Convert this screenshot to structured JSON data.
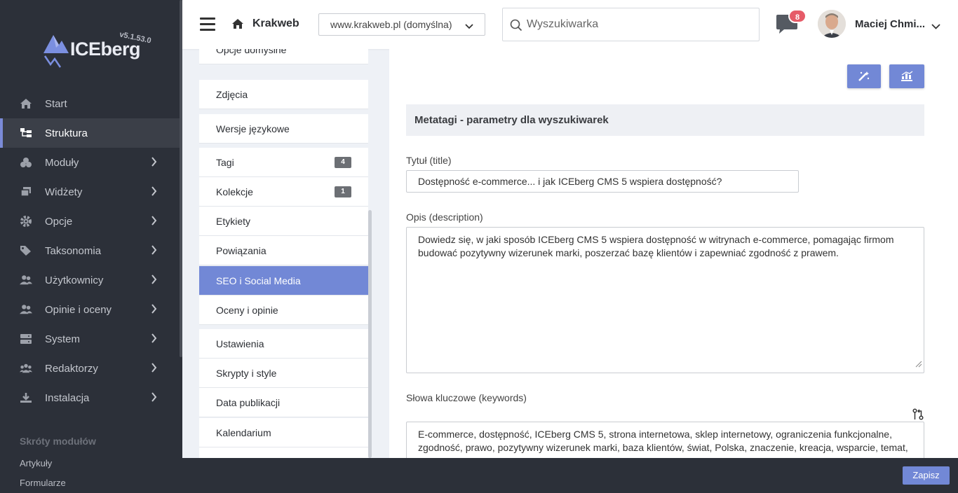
{
  "brand": {
    "name": "ICEberg",
    "version": "v5.1.53.0"
  },
  "sidebar": {
    "items": [
      {
        "label": "Start",
        "icon": "home-icon"
      },
      {
        "label": "Struktura",
        "icon": "structure-icon"
      },
      {
        "label": "Moduły",
        "icon": "modules-icon"
      },
      {
        "label": "Widżety",
        "icon": "widgets-icon"
      },
      {
        "label": "Opcje",
        "icon": "gear-icon"
      },
      {
        "label": "Taksonomia",
        "icon": "tags-icon"
      },
      {
        "label": "Użytkownicy",
        "icon": "users-icon"
      },
      {
        "label": "Opinie i oceny",
        "icon": "users-icon"
      },
      {
        "label": "System",
        "icon": "server-icon"
      },
      {
        "label": "Redaktorzy",
        "icon": "editors-icon"
      },
      {
        "label": "Instalacja",
        "icon": "download-icon"
      }
    ],
    "active_index": 1,
    "shortcuts_title": "Skróty modułów",
    "shortcuts": [
      "Artykuły",
      "Formularze"
    ]
  },
  "topbar": {
    "site_name": "Krakweb",
    "domain": "www.krakweb.pl (domyślna)",
    "search_placeholder": "Wyszukiwarka",
    "notifications_count": "8",
    "user_name": "Maciej Chmi..."
  },
  "submenu": {
    "partial_top": "Opcje domyślne",
    "items": [
      {
        "label": "Zdjęcia"
      },
      {
        "label": "Wersje językowe"
      },
      {
        "label": "Tagi",
        "count": "4"
      },
      {
        "label": "Kolekcje",
        "count": "1"
      },
      {
        "label": "Etykiety"
      },
      {
        "label": "Powiązania"
      },
      {
        "label": "SEO i Social Media"
      },
      {
        "label": "Oceny i opinie"
      },
      {
        "label": "Ustawienia"
      },
      {
        "label": "Skrypty i style"
      },
      {
        "label": "Data publikacji"
      },
      {
        "label": "Kalendarium"
      }
    ],
    "active_label": "SEO i Social Media"
  },
  "main": {
    "section_title": "Metatagi - parametry dla wyszukiwarek",
    "title_label": "Tytuł (title)",
    "title_value": "Dostępność e-commerce... i jak ICEberg CMS 5 wspiera dostępność?",
    "description_label": "Opis (description)",
    "description_value": "Dowiedz się, w jaki sposób ICEberg CMS 5 wspiera dostępność w witrynach e-commerce, pomagając firmom budować pozytywny wizerunek marki, poszerzać bazę klientów i zapewniać zgodność z prawem.",
    "keywords_label": "Słowa kluczowe (keywords)",
    "keywords_value": "E-commerce, dostępność, ICEberg CMS 5, strona internetowa, sklep internetowy, ograniczenia funkcjonalne, zgodność, prawo, pozytywny wizerunek marki, baza klientów, świat, Polska, znaczenie, kreacja, wsparcie, temat,"
  },
  "footer": {
    "save_label": "Zapisz"
  },
  "colors": {
    "accent": "#7288d6",
    "sidebar_bg": "#2c3039",
    "badge": "#e65b68"
  }
}
